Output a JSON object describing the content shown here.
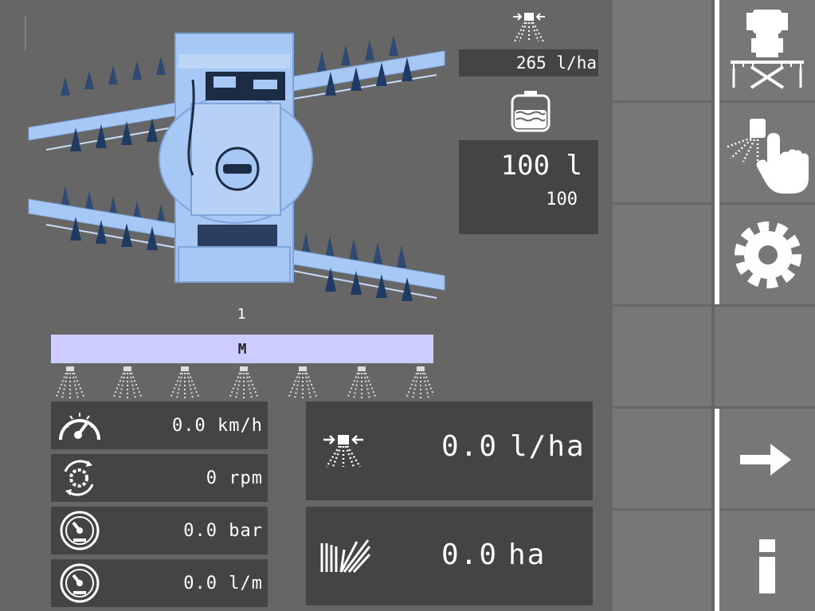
{
  "sprayer": {
    "rate_target": "265 l/ha",
    "tank_volume": "100 l",
    "tank_percent": "100",
    "section_number": "1",
    "section_mode": "M"
  },
  "readouts": {
    "speed": "0.0 km/h",
    "rpm": "0 rpm",
    "pressure": "0.0 bar",
    "flow": "0.0 l/m",
    "rate": "0.0",
    "rate_unit": "l/ha",
    "area": "0.0",
    "area_unit": "ha"
  },
  "icons": {
    "sidebar": [
      "tractor-boom-icon",
      "manual-spray-hand-icon",
      "gear-icon",
      "arrow-right-icon",
      "info-icon"
    ],
    "readouts": [
      "speedometer-icon",
      "rpm-gear-icon",
      "pressure-gauge-icon",
      "flow-gauge-icon",
      "spray-rate-icon",
      "field-area-icon"
    ]
  },
  "colors": {
    "background": "#666666",
    "panel": "#444444",
    "button": "#777777",
    "section_bar": "#ccccff",
    "sprayer_blue": "#a7c8f4"
  }
}
